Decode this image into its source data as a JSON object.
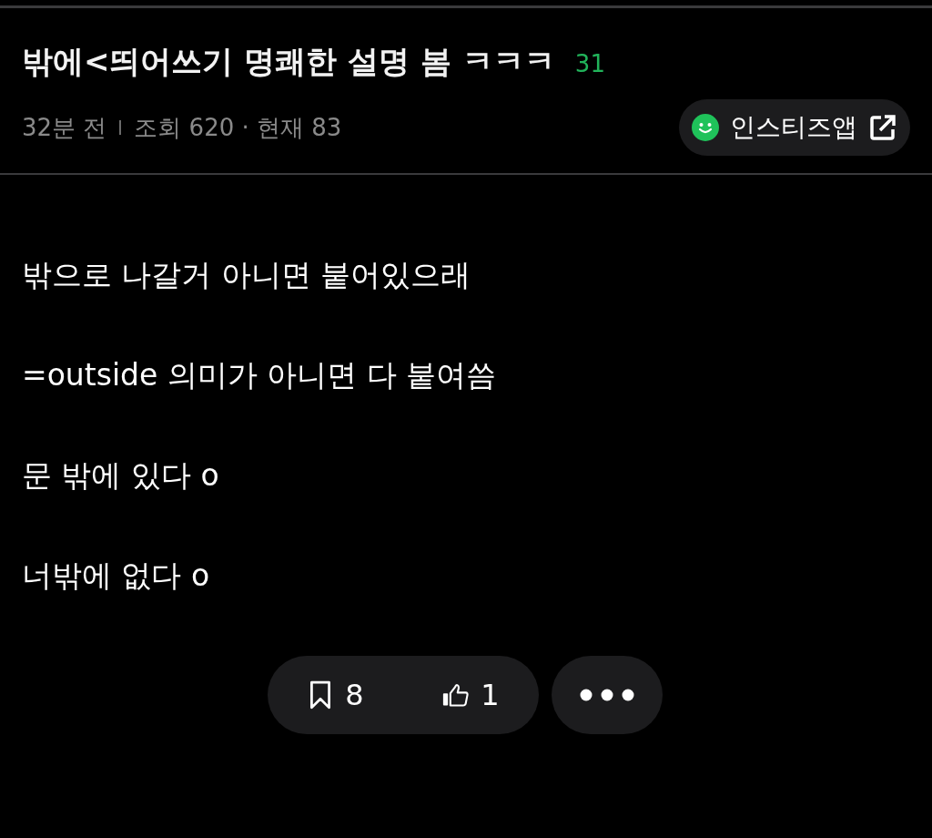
{
  "post": {
    "title": "밖에<띄어쓰기 명쾌한 설명 봄 ㅋㅋㅋ",
    "comment_count": "31",
    "time": "32분 전",
    "views": "조회 620 · 현재 83",
    "app_button": "인스티즈앱"
  },
  "body": [
    "밖으로 나갈거 아니면 붙어있으래",
    "=outside 의미가 아니면 다 붙여씀",
    "문 밖에 있다 o",
    "너밖에 없다 o"
  ],
  "actions": [
    {
      "kind": "bookmark",
      "count": "8"
    },
    {
      "kind": "like",
      "count": "1"
    }
  ]
}
